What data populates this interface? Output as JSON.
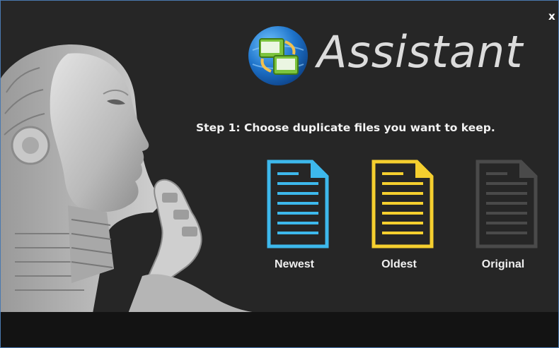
{
  "window": {
    "app_title": "Assistant",
    "close_label": "x"
  },
  "wizard": {
    "step_title": "Step 1:  Choose duplicate files you want to keep.",
    "options": [
      {
        "label": "Newest",
        "icon": "document-icon",
        "color": "#3db8ec"
      },
      {
        "label": "Oldest",
        "icon": "document-icon",
        "color": "#f5cf2f"
      },
      {
        "label": "Original",
        "icon": "document-icon",
        "color": "#4a4a4a"
      }
    ]
  },
  "colors": {
    "background": "#262626",
    "bottom_bar": "#131313",
    "window_border": "#4a79b0",
    "title_text": "#dcdcdc"
  }
}
